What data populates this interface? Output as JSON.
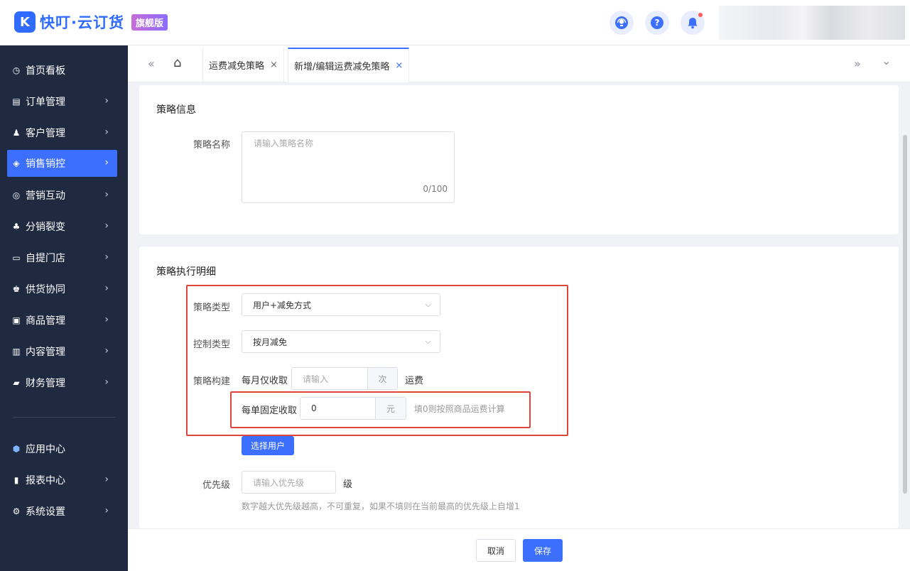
{
  "header": {
    "logo_glyph": "K",
    "app_name": "快叮·云订货",
    "edition_badge": "旗舰版",
    "icons": [
      "customer-service-icon",
      "help-icon",
      "bell-icon"
    ],
    "help_glyph": "?"
  },
  "sidebar": {
    "items": [
      {
        "label": "首页看板",
        "icon": "dashboard-icon",
        "glyph": "◷"
      },
      {
        "label": "订单管理",
        "icon": "order-icon",
        "glyph": "▤"
      },
      {
        "label": "客户管理",
        "icon": "customer-icon",
        "glyph": "♟"
      },
      {
        "label": "销售销控",
        "icon": "sales-tag-icon",
        "glyph": "◈"
      },
      {
        "label": "营销互动",
        "icon": "marketing-icon",
        "glyph": "◎"
      },
      {
        "label": "分销裂变",
        "icon": "distribution-icon",
        "glyph": "♣"
      },
      {
        "label": "自提门店",
        "icon": "store-icon",
        "glyph": "▭"
      },
      {
        "label": "供货协同",
        "icon": "supply-icon",
        "glyph": "♚"
      },
      {
        "label": "商品管理",
        "icon": "goods-icon",
        "glyph": "▣"
      },
      {
        "label": "内容管理",
        "icon": "content-icon",
        "glyph": "▥"
      },
      {
        "label": "财务管理",
        "icon": "finance-icon",
        "glyph": "▰"
      },
      {
        "label": "应用中心",
        "icon": "app-center-icon",
        "glyph": "⬢"
      },
      {
        "label": "报表中心",
        "icon": "report-icon",
        "glyph": "▮"
      },
      {
        "label": "系统设置",
        "icon": "settings-icon",
        "glyph": "⚙"
      }
    ],
    "active": "销售销控",
    "chevron": "›"
  },
  "tabs": {
    "collapse_glyph": "«",
    "expand_glyph": "»",
    "more_glyph": "⌄",
    "home_glyph": "⌂",
    "close_glyph": "×",
    "items": [
      {
        "label": "运费减免策略"
      },
      {
        "label": "新增/编辑运费减免策略"
      }
    ]
  },
  "info": {
    "title": "策略信息",
    "name_label": "策略名称",
    "name_placeholder": "请输入策略名称",
    "name_counter": "0/100"
  },
  "detail": {
    "title": "策略执行明细",
    "type_label": "策略类型",
    "type_value": "用户+减免方式",
    "control_label": "控制类型",
    "control_value": "按月减免",
    "build_label": "策略构建",
    "monthly_text": "每月仅收取",
    "monthly_placeholder": "请输入",
    "monthly_unit": "次",
    "monthly_suffix": "运费",
    "fixed_text": "每单固定收取",
    "fixed_value": "0",
    "fixed_unit": "元",
    "fixed_hint": "填0则按照商品运费计算",
    "select_user_button": "选择用户",
    "priority_label": "优先级",
    "priority_placeholder": "请输入优先级",
    "priority_unit": "级",
    "priority_hint": "数字越大优先级越高，不可重复，如果不填则在当前最高的优先级上自增1",
    "dropdown_arrow": "⌵"
  },
  "footer": {
    "cancel": "取消",
    "save": "保存"
  },
  "colors": {
    "primary": "#3d6fff",
    "sidebar_bg": "#1f2940",
    "highlight_box": "#e0453b"
  }
}
